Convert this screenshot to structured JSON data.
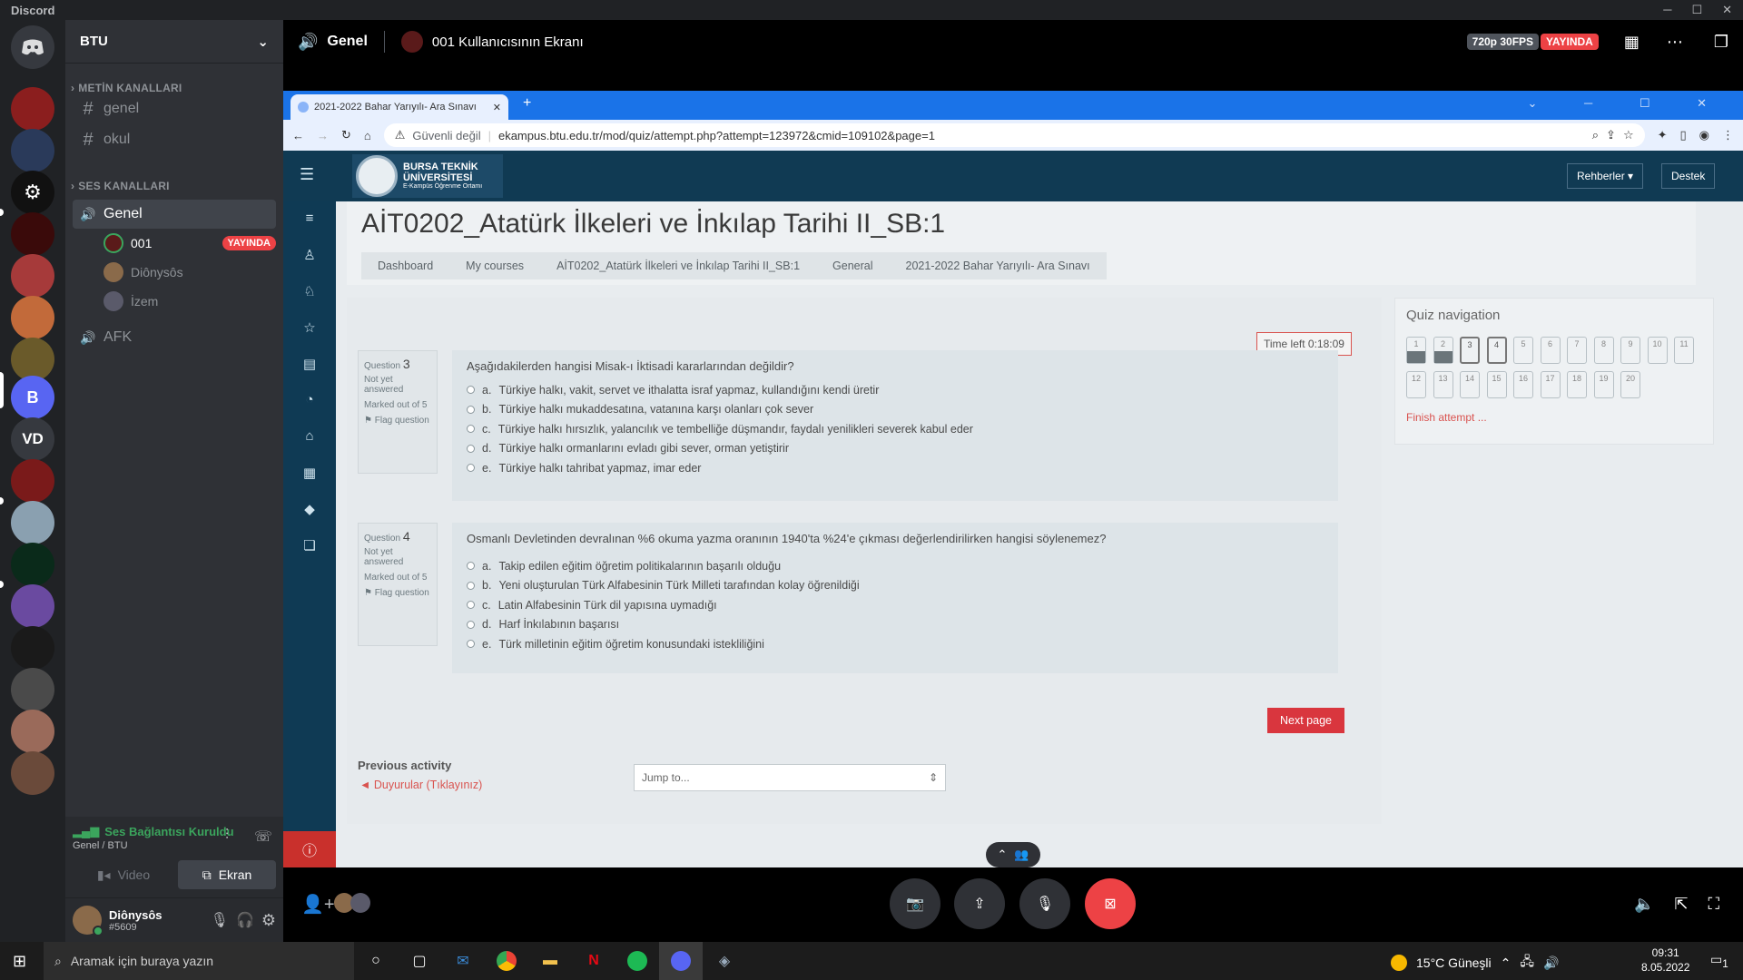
{
  "titlebar": {
    "app": "Discord",
    "min": "─",
    "max": "☐",
    "close": "✕"
  },
  "rail": {
    "vd_label": "VD",
    "b_label": "B"
  },
  "sidebar": {
    "guild_name": "BTU",
    "text_category": "METİN KANALLARI",
    "text_channels": [
      "genel",
      "okul"
    ],
    "voice_category": "SES KANALLARI",
    "voice_channel": "Genel",
    "voice_users": [
      {
        "name": "001",
        "live": "YAYINDA"
      },
      {
        "name": "Diônysôs"
      },
      {
        "name": "İzem"
      }
    ],
    "afk_channel": "AFK"
  },
  "voice_connection": {
    "status": "Ses Bağlantısı Kuruldu",
    "location": "Genel / BTU",
    "video_label": "Video",
    "screen_label": "Ekran"
  },
  "user": {
    "name": "Diônysôs",
    "tag": "#5609"
  },
  "stream_header": {
    "channel": "Genel",
    "streamer": "001 Kullanıcısının Ekranı",
    "quality": "720p 30FPS",
    "live": "YAYINDA"
  },
  "browser": {
    "tab_title": "2021-2022 Bahar Yarıyılı- Ara Sınavı",
    "security": "Güvenli değil",
    "url": "ekampus.btu.edu.tr/mod/quiz/attempt.php?attempt=123972&cmid=109102&page=1"
  },
  "moodle": {
    "logo_line1": "BURSA TEKNİK",
    "logo_line2": "ÜNİVERSİTESİ",
    "logo_line3": "E-Kampüs Öğrenme Ortamı",
    "guides_button": "Rehberler ▾",
    "support_button": "Destek",
    "course_title": "AİT0202_Atatürk İlkeleri ve İnkılap Tarihi II_SB:1",
    "breadcrumbs": [
      "Dashboard",
      "My courses",
      "AİT0202_Atatürk İlkeleri ve İnkılap Tarihi II_SB:1",
      "General",
      "2021-2022 Bahar Yarıyılı- Ara Sınavı"
    ],
    "timer": "Time left 0:18:09",
    "questions": [
      {
        "label": "Question",
        "number": "3",
        "status": "Not yet answered",
        "marks": "Marked out of 5",
        "flag": "Flag question",
        "text": "Aşağıdakilerden hangisi Misak-ı İktisadi kararlarından değildir?",
        "options": [
          {
            "letter": "a.",
            "text": "Türkiye halkı, vakit, servet ve ithalatta israf yapmaz, kullandığını kendi üretir"
          },
          {
            "letter": "b.",
            "text": "Türkiye halkı mukaddesatına, vatanına karşı olanları çok sever"
          },
          {
            "letter": "c.",
            "text": "Türkiye halkı hırsızlık, yalancılık ve tembelliğe düşmandır, faydalı yenilikleri severek kabul eder"
          },
          {
            "letter": "d.",
            "text": "Türkiye halkı ormanlarını evladı gibi sever, orman yetiştirir"
          },
          {
            "letter": "e.",
            "text": "Türkiye halkı tahribat yapmaz, imar eder"
          }
        ]
      },
      {
        "label": "Question",
        "number": "4",
        "status": "Not yet answered",
        "marks": "Marked out of 5",
        "flag": "Flag question",
        "text": "Osmanlı Devletinden devralınan %6 okuma yazma oranının 1940'ta %24'e çıkması değerlendirilirken hangisi söylenemez?",
        "options": [
          {
            "letter": "a.",
            "text": "Takip edilen eğitim öğretim politikalarının başarılı olduğu"
          },
          {
            "letter": "b.",
            "text": "Yeni oluşturulan Türk Alfabesinin Türk Milleti tarafından kolay öğrenildiği"
          },
          {
            "letter": "c.",
            "text": "Latin Alfabesinin Türk dil yapısına uymadığı"
          },
          {
            "letter": "d.",
            "text": "Harf İnkılabının başarısı"
          },
          {
            "letter": "e.",
            "text": "Türk milletinin eğitim öğretim konusundaki istekliliğini"
          }
        ]
      }
    ],
    "next_page": "Next page",
    "previous_activity_label": "Previous activity",
    "previous_activity_link": "◄ Duyurular (Tıklayınız)",
    "jump_to": "Jump to...",
    "quiz_nav_title": "Quiz navigation",
    "quiz_nav_numbers": [
      "1",
      "2",
      "3",
      "4",
      "5",
      "6",
      "7",
      "8",
      "9",
      "10",
      "11",
      "12",
      "13",
      "14",
      "15",
      "16",
      "17",
      "18",
      "19",
      "20"
    ],
    "finish_attempt": "Finish attempt ..."
  },
  "taskbar": {
    "search_placeholder": "Aramak için buraya yazın",
    "weather": "15°C Güneşli",
    "time": "09:31",
    "date": "8.05.2022",
    "notif_count": "1"
  }
}
